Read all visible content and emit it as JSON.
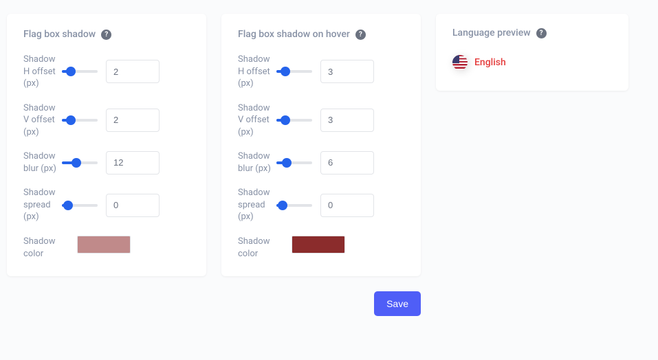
{
  "cards": {
    "shadow": {
      "title": "Flag box shadow",
      "h_offset_label": "Shadow H offset (px)",
      "h_offset_value": "2",
      "v_offset_label": "Shadow V offset (px)",
      "v_offset_value": "2",
      "blur_label": "Shadow blur (px)",
      "blur_value": "12",
      "spread_label": "Shadow spread (px)",
      "spread_value": "0",
      "color_label": "Shadow color",
      "color_value": "#c08a8a"
    },
    "shadow_hover": {
      "title": "Flag box shadow on hover",
      "h_offset_label": "Shadow H offset (px)",
      "h_offset_value": "3",
      "v_offset_label": "Shadow V offset (px)",
      "v_offset_value": "3",
      "blur_label": "Shadow blur (px)",
      "blur_value": "6",
      "spread_label": "Shadow spread (px)",
      "spread_value": "0",
      "color_label": "Shadow color",
      "color_value": "#8b2c2c"
    },
    "preview": {
      "title": "Language preview",
      "language_label": "English"
    }
  },
  "save_label": "Save"
}
